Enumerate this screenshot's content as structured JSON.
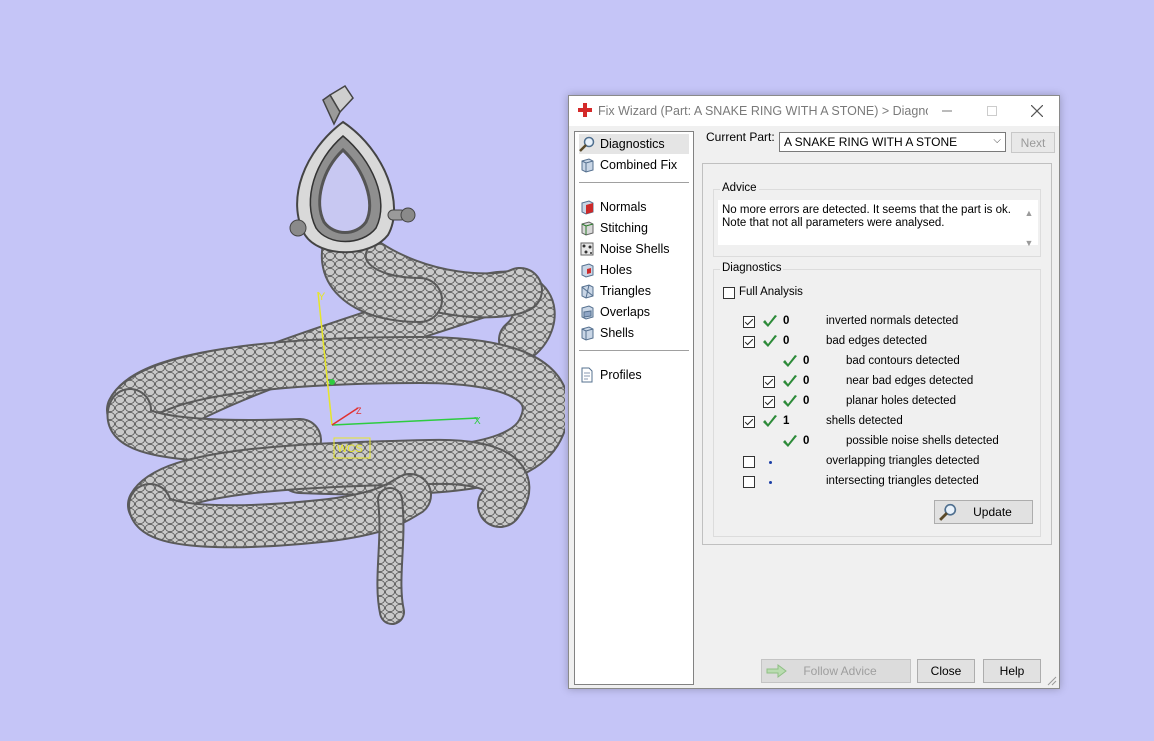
{
  "viewport": {
    "wcs_label": "WCS",
    "axis_x": "X",
    "axis_y": "Y",
    "axis_z": "Z"
  },
  "dialog": {
    "title": "Fix Wizard (Part: A SNAKE RING WITH A STONE) > Diagnosti...",
    "sidebar": {
      "top": [
        {
          "label": "Diagnostics",
          "icon": "magnifier-icon"
        },
        {
          "label": "Combined Fix",
          "icon": "cube-icon"
        }
      ],
      "fixes": [
        {
          "label": "Normals",
          "icon": "normals-icon"
        },
        {
          "label": "Stitching",
          "icon": "stitching-icon"
        },
        {
          "label": "Noise Shells",
          "icon": "noise-shells-icon"
        },
        {
          "label": "Holes",
          "icon": "holes-icon"
        },
        {
          "label": "Triangles",
          "icon": "triangles-icon"
        },
        {
          "label": "Overlaps",
          "icon": "overlaps-icon"
        },
        {
          "label": "Shells",
          "icon": "shells-icon"
        }
      ],
      "bottom": [
        {
          "label": "Profiles",
          "icon": "document-icon"
        }
      ]
    },
    "current_part_label": "Current Part:",
    "current_part_value": "A SNAKE RING WITH A STONE",
    "next_label": "Next",
    "advice": {
      "title": "Advice",
      "line1": "No more errors are detected. It seems that the part is ok.",
      "line2": "Note that not all parameters were analysed."
    },
    "diagnostics": {
      "title": "Diagnostics",
      "full_analysis_label": "Full Analysis",
      "rows": [
        {
          "checkbox": true,
          "checked": true,
          "status": "ok",
          "count": "0",
          "label": "inverted normals detected",
          "indent": 0
        },
        {
          "checkbox": true,
          "checked": true,
          "status": "ok",
          "count": "0",
          "label": "bad edges detected",
          "indent": 0
        },
        {
          "checkbox": false,
          "checked": false,
          "status": "ok",
          "count": "0",
          "label": "bad contours detected",
          "indent": 1
        },
        {
          "checkbox": true,
          "checked": true,
          "status": "ok",
          "count": "0",
          "label": "near bad edges detected",
          "indent": 1
        },
        {
          "checkbox": true,
          "checked": true,
          "status": "ok",
          "count": "0",
          "label": "planar holes detected",
          "indent": 1
        },
        {
          "checkbox": true,
          "checked": true,
          "status": "ok",
          "count": "1",
          "label": "shells detected",
          "indent": 0
        },
        {
          "checkbox": false,
          "checked": false,
          "status": "ok",
          "count": "0",
          "label": "possible noise shells detected",
          "indent": 1
        },
        {
          "checkbox": true,
          "checked": false,
          "status": "pending",
          "count": "",
          "label": "overlapping triangles detected",
          "indent": 0
        },
        {
          "checkbox": true,
          "checked": false,
          "status": "pending",
          "count": "",
          "label": "intersecting triangles detected",
          "indent": 0
        }
      ],
      "update_label": "Update"
    },
    "buttons": {
      "follow_advice": "Follow Advice",
      "close": "Close",
      "help": "Help"
    },
    "colors": {
      "check_green": "#2e8b3a",
      "accent_red": "#d42a2a"
    }
  }
}
